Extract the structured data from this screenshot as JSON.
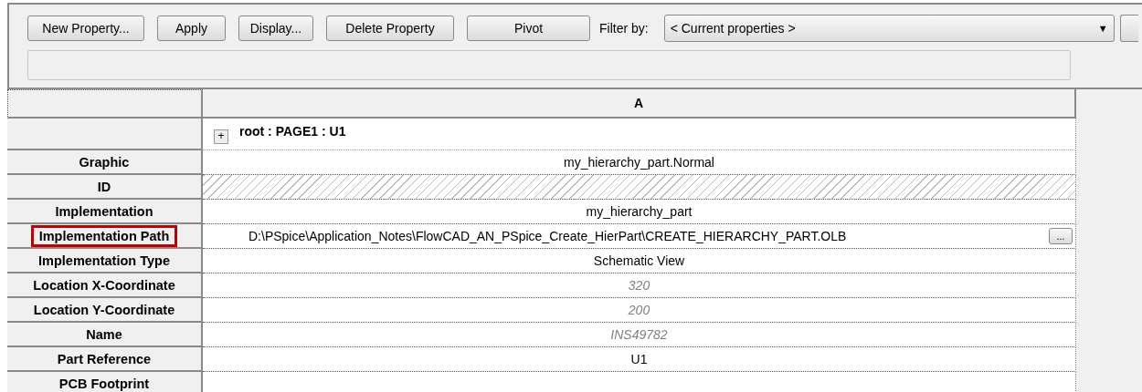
{
  "toolbar": {
    "buttons": [
      "New Property...",
      "Apply",
      "Display...",
      "Delete Property",
      "Pivot"
    ],
    "filter_label": "Filter by:",
    "filter_value": "< Current properties >",
    "arrow": "▼"
  },
  "grid": {
    "column_header": "A",
    "root_expander": "+",
    "root": "root : PAGE1 : U1",
    "rows": [
      {
        "label": "Graphic",
        "kind": "text",
        "value": "my_hierarchy_part.Normal",
        "highlighted": false
      },
      {
        "label": "ID",
        "kind": "blocked",
        "highlighted": false
      },
      {
        "label": "Implementation",
        "kind": "text",
        "value": "my_hierarchy_part",
        "highlighted": false
      },
      {
        "label": "Implementation Path",
        "kind": "path",
        "value": "D:\\PSpice\\Application_Notes\\FlowCAD_AN_PSpice_Create_HierPart\\CREATE_HIERARCHY_PART.OLB",
        "browse": "...",
        "highlighted": true
      },
      {
        "label": "Implementation Type",
        "kind": "text",
        "value": "Schematic View",
        "highlighted": false
      },
      {
        "label": "Location X-Coordinate",
        "kind": "default",
        "value": "320",
        "highlighted": false
      },
      {
        "label": "Location Y-Coordinate",
        "kind": "default",
        "value": "200",
        "highlighted": false
      },
      {
        "label": "Name",
        "kind": "default",
        "value": "INS49782",
        "highlighted": false
      },
      {
        "label": "Part Reference",
        "kind": "text",
        "value": "U1",
        "highlighted": false
      },
      {
        "label": "PCB Footprint",
        "kind": "text",
        "highlighted": false
      }
    ]
  }
}
